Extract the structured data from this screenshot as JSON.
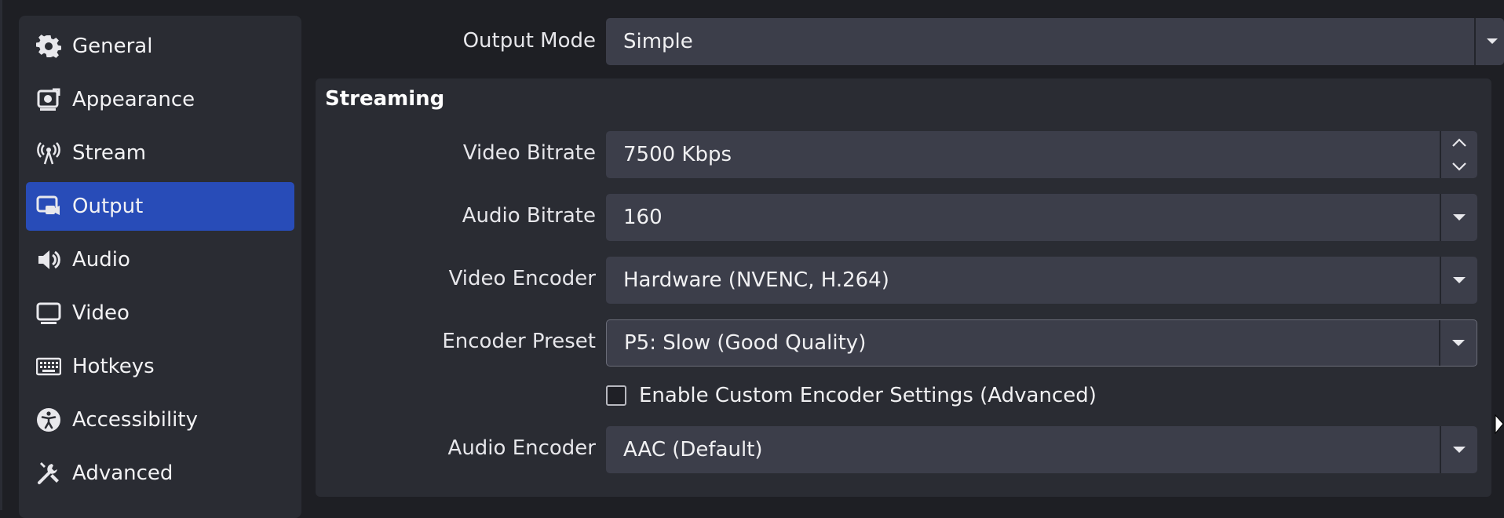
{
  "sidebar": {
    "items": [
      {
        "label": "General",
        "icon": "gear-icon"
      },
      {
        "label": "Appearance",
        "icon": "appearance-icon"
      },
      {
        "label": "Stream",
        "icon": "broadcast-antenna-icon"
      },
      {
        "label": "Output",
        "icon": "output-icon",
        "active": true
      },
      {
        "label": "Audio",
        "icon": "speaker-icon"
      },
      {
        "label": "Video",
        "icon": "monitor-icon"
      },
      {
        "label": "Hotkeys",
        "icon": "keyboard-icon"
      },
      {
        "label": "Accessibility",
        "icon": "accessibility-icon"
      },
      {
        "label": "Advanced",
        "icon": "tools-icon"
      }
    ]
  },
  "output": {
    "mode_label": "Output Mode",
    "mode_value": "Simple"
  },
  "streaming": {
    "title": "Streaming",
    "video_bitrate_label": "Video Bitrate",
    "video_bitrate_value": "7500 Kbps",
    "audio_bitrate_label": "Audio Bitrate",
    "audio_bitrate_value": "160",
    "video_encoder_label": "Video Encoder",
    "video_encoder_value": "Hardware (NVENC, H.264)",
    "encoder_preset_label": "Encoder Preset",
    "encoder_preset_value": "P5: Slow (Good Quality)",
    "custom_encoder_label": "Enable Custom Encoder Settings (Advanced)",
    "custom_encoder_checked": false,
    "audio_encoder_label": "Audio Encoder",
    "audio_encoder_value": "AAC (Default)"
  },
  "colors": {
    "background": "#1e1f24",
    "panel": "#2a2c33",
    "field": "#3c3e4a",
    "accent": "#284cb8"
  }
}
